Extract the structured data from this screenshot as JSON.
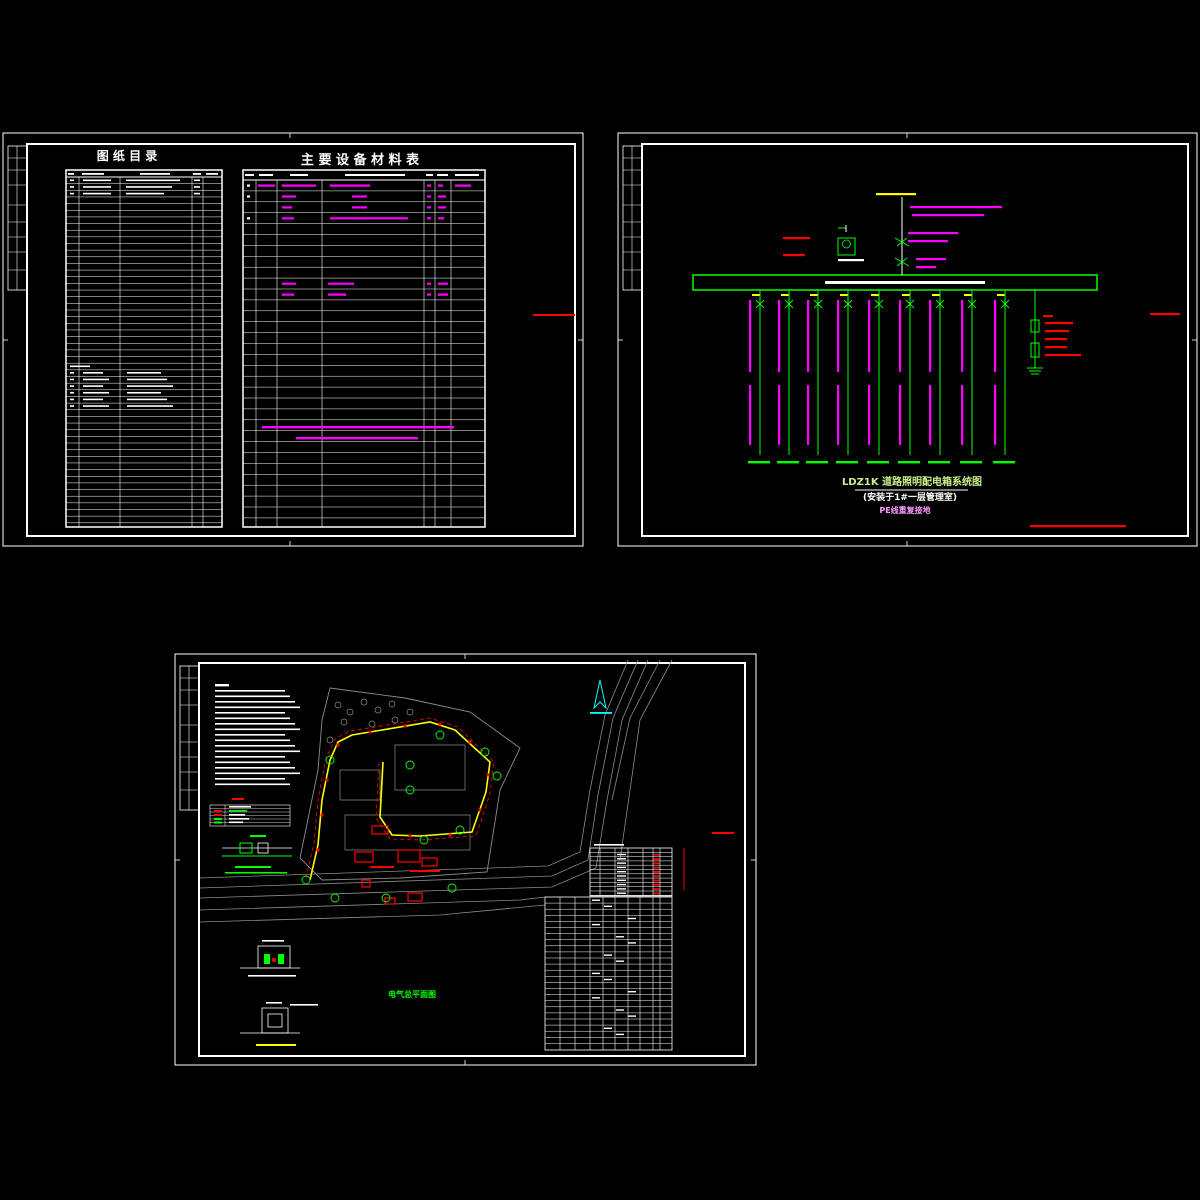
{
  "canvas": {
    "background": "#000000"
  },
  "colors": {
    "frame": "#ffffff",
    "magenta": "#ff00ff",
    "green": "#00ff00",
    "red": "#ff0000",
    "yellow": "#ffff00",
    "gray": "#8c8c8c",
    "cyan": "#00ffff"
  },
  "sheet1": {
    "directory_title": "图 纸 目 录",
    "materials_title": "主 要 设 备 材 料 表"
  },
  "sheet2": {
    "system_title": "LDZ1K 道路照明配电箱系统图",
    "install_note": "(安装于1#一层管理室)",
    "pe_note": "PE线重复接地"
  },
  "sheet3": {
    "plan_title": "电气总平面图"
  }
}
